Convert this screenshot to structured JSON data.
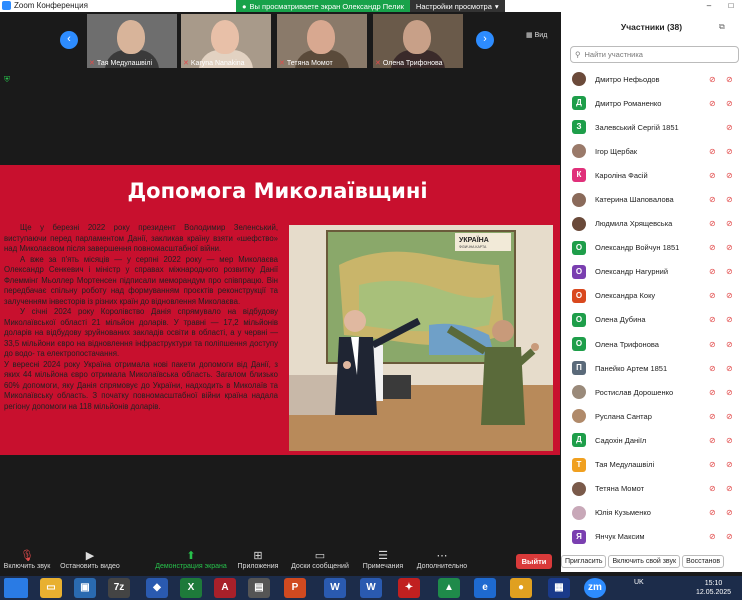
{
  "window": {
    "title": "Zoom Конференция"
  },
  "share_banner": {
    "message": "Вы просматриваете экран Олександр Пелик",
    "view_options": "Настройки просмотра"
  },
  "video_strip": {
    "view_label": "Вид",
    "tiles": [
      {
        "name": "Тая Медулашвілі",
        "muted": true
      },
      {
        "name": "Karyna Nanakina",
        "muted": true
      },
      {
        "name": "Тетяна Момот",
        "muted": true
      },
      {
        "name": "Олена Трифонова",
        "muted": true
      }
    ]
  },
  "slide": {
    "title": "Допомога Миколаївщині",
    "paragraphs": [
      "Ще у березні 2022 року президент Володимир Зеленський, виступаючи перед парламентом Данії, закликав країну взяти «шефство» над Миколаєвом після завершення повномасштабної війни.",
      "А вже за п'ять місяців — у серпні 2022 року — мер Миколаєва Олександр Сенкевич і міністр у справах міжнародного розвитку Данії Флеммінг Мьоллер Мортенсен підписали меморандум про співпрацю. Він передбачає спільну роботу над формуванням проєктів реконструкції та залученням інвесторів із різних країн до відновлення Миколаєва.",
      "У січні 2024 року Королівство Данія спрямувало на відбудову Миколаївської області 21 мільйон доларів. У травні — 17,2 мільйонів доларів на відбудову зруйнованих закладів освіти в області, а у червні — 33,5 мільйони євро на відновлення інфраструктури та поліпшення доступу до водо- та електропостачання.",
      "У вересні 2024 року Україна отримала нові пакети допомоги від Данії, з яких 44 мільйона євро отримала Миколаївська область. Загалом близько 60% допомоги, яку Данія спрямовує до України, надходить в Миколаїв та Миколаївську область. З початку повномасштабної війни країна надала регіону допомоги на 118 мільйонів доларів."
    ],
    "map_title": "УКРАЇНА",
    "map_subtitle": "ФІЗИЧНА КАРТА"
  },
  "participants": {
    "title": "Участники (38)",
    "search_placeholder": "Найти участника",
    "list": [
      {
        "name": "Дмитро Нефьодов",
        "avatar": "photo",
        "color": "#6b4a3a"
      },
      {
        "name": "Дмитро Романенко",
        "avatar": "Д",
        "color": "#1e9e4a"
      },
      {
        "name": "Залевський Сергій 1851",
        "avatar": "З",
        "color": "#1e9e4a"
      },
      {
        "name": "Ігор Щербак",
        "avatar": "photo",
        "color": "#9a7a6a"
      },
      {
        "name": "Кароліна Фасій",
        "avatar": "К",
        "color": "#e0307a"
      },
      {
        "name": "Катерина Шаповалова",
        "avatar": "photo",
        "color": "#8a6a5a"
      },
      {
        "name": "Людмила Хрящевська",
        "avatar": "photo",
        "color": "#6a4a3a"
      },
      {
        "name": "Олександр Войчун 1851",
        "avatar": "О",
        "color": "#1e9e4a"
      },
      {
        "name": "Олександр Нагурний",
        "avatar": "О",
        "color": "#7a3fb0"
      },
      {
        "name": "Олександра Кокy",
        "avatar": "О",
        "color": "#d9481e"
      },
      {
        "name": "Олена Дубина",
        "avatar": "О",
        "color": "#1e9e4a"
      },
      {
        "name": "Олена Трифонова",
        "avatar": "О",
        "color": "#1e9e4a"
      },
      {
        "name": "Панейко Артем 1851",
        "avatar": "П",
        "color": "#5a6a7a"
      },
      {
        "name": "Ростислав Дорошенко",
        "avatar": "photo",
        "color": "#9a8a7a"
      },
      {
        "name": "Руслана Сантар",
        "avatar": "photo",
        "color": "#b08a6a"
      },
      {
        "name": "Садохін Даніїл",
        "avatar": "Д",
        "color": "#1e9e4a"
      },
      {
        "name": "Тая Медулашвілі",
        "avatar": "Т",
        "color": "#f0a020"
      },
      {
        "name": "Тетяна Момот",
        "avatar": "photo",
        "color": "#7a5a4a"
      },
      {
        "name": "Юлія Кузьменко",
        "avatar": "photo",
        "color": "#c8a8b8"
      },
      {
        "name": "Янчук Максим",
        "avatar": "Я",
        "color": "#7a3fb0"
      }
    ],
    "footer": {
      "invite": "Пригласить",
      "unmute_me": "Включить свой звук",
      "restore": "Восстанов"
    }
  },
  "toolbar": {
    "unmute": "Включить звук",
    "start_video": "Остановить видео",
    "share_screen": "Демонстрация экрана",
    "apps": "Приложения",
    "whiteboards": "Доски сообщений",
    "notes": "Примечания",
    "more": "Дополнительно",
    "leave": "Выйти"
  },
  "taskbar": {
    "lang": "UK",
    "time": "15:10",
    "date": "12.05.2025"
  },
  "colors": {
    "accent": "#2d8cff",
    "slide_bg": "#c8102e",
    "share_green": "#18a24a",
    "leave_red": "#d93a3a"
  }
}
